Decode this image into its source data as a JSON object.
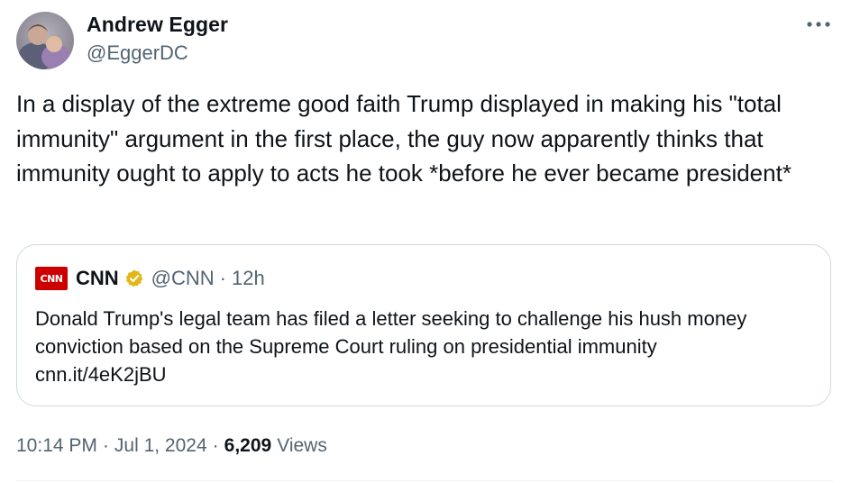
{
  "author": {
    "name": "Andrew Egger",
    "handle": "@EggerDC",
    "avatar_icon": "profile-photo"
  },
  "more_icon": "more-horizontal-icon",
  "tweet": {
    "text": "In a display of the extreme good faith Trump displayed in making his \"total immunity\" argument in the first place, the guy now apparently thinks that immunity ought to apply to acts he took *before he ever became president*"
  },
  "quote": {
    "logo_text": "CNN",
    "name": "CNN",
    "verified_icon": "gold-verified-badge-icon",
    "handle": "@CNN",
    "separator": "·",
    "time": "12h",
    "text": "Donald Trump's legal team has filed a letter seeking to challenge his hush money conviction based on the Supreme Court ruling on presidential immunity",
    "link": "cnn.it/4eK2jBU"
  },
  "meta": {
    "time": "10:14 PM",
    "sep1": "·",
    "date": "Jul 1, 2024",
    "sep2": "·",
    "views_count": "6,209",
    "views_label": "Views"
  },
  "colors": {
    "text": "#0f1419",
    "secondary": "#536471",
    "border": "#cfd9de",
    "cnn_red": "#cc0000",
    "verified_gold": "#e2b719"
  }
}
